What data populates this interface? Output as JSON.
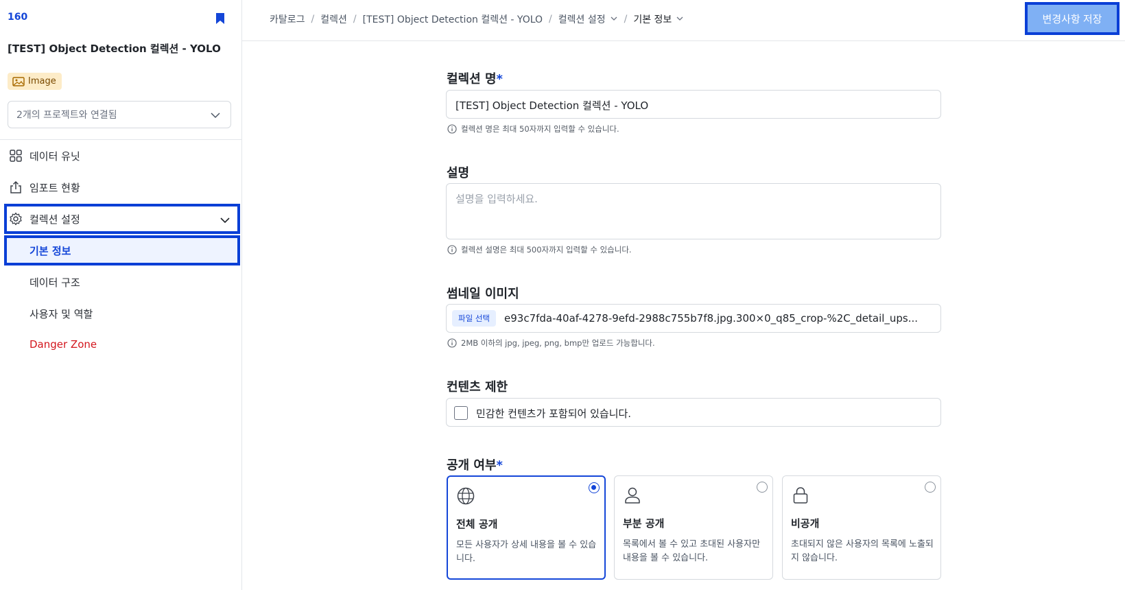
{
  "sidebar": {
    "id": "160",
    "title": "[TEST] Object Detection 컬렉션 - YOLO",
    "badge": "Image",
    "project_select": "2개의 프로젝트와 연결됨",
    "nav": [
      {
        "label": "데이터 유닛",
        "icon": "grid-icon"
      },
      {
        "label": "임포트 현황",
        "icon": "upload-icon"
      },
      {
        "label": "컬렉션 설정",
        "icon": "gear-icon"
      }
    ],
    "sub": [
      {
        "label": "기본 정보"
      },
      {
        "label": "데이터 구조"
      },
      {
        "label": "사용자 및 역할"
      },
      {
        "label": "Danger Zone"
      }
    ]
  },
  "breadcrumb": {
    "items": [
      "카탈로그",
      "컬렉션",
      "[TEST] Object Detection 컬렉션 - YOLO",
      "컬렉션 설정",
      "기본 정보"
    ],
    "separator": "/"
  },
  "toolbar": {
    "save_label": "변경사항 저장"
  },
  "form": {
    "name": {
      "label": "컬렉션 명",
      "required": "*",
      "value": "[TEST] Object Detection 컬렉션 - YOLO",
      "hint": "컬렉션 명은 최대 50자까지 입력할 수 있습니다."
    },
    "description": {
      "label": "설명",
      "placeholder": "설명을 입력하세요.",
      "hint": "컬렉션 설명은 최대 500자까지 입력할 수 있습니다."
    },
    "thumbnail": {
      "label": "썸네일 이미지",
      "button": "파일 선택",
      "filename": "e93c7fda-40af-4278-9efd-2988c755b7f8.jpg.300×0_q85_crop-%2C_detail_ups...",
      "hint": "2MB 이하의 jpg, jpeg, png, bmp만 업로드 가능합니다."
    },
    "content_restriction": {
      "label": "컨텐츠 제한",
      "checkbox_label": "민감한 컨텐츠가 포함되어 있습니다.",
      "checked": false
    },
    "visibility": {
      "label": "공개 여부",
      "required": "*",
      "options": [
        {
          "title": "전체 공개",
          "desc": "모든 사용자가 상세 내용을 볼 수 있습니다.",
          "icon": "globe-icon",
          "selected": true
        },
        {
          "title": "부분 공개",
          "desc": "목록에서 볼 수 있고 초대된 사용자만 내용을 볼 수 있습니다.",
          "icon": "user-icon",
          "selected": false
        },
        {
          "title": "비공개",
          "desc": "초대되지 않은 사용자의 목록에 노출되지 않습니다.",
          "icon": "lock-icon",
          "selected": false
        }
      ]
    }
  },
  "colors": {
    "accent": "#1446d8",
    "highlight": "#0a3fd6",
    "save_button": "#7fb0f4",
    "badge_bg": "#fdecc8",
    "danger": "#d3151c"
  }
}
